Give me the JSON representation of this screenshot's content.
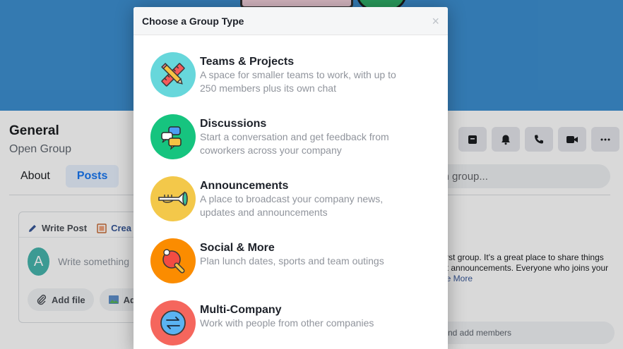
{
  "group": {
    "name": "General",
    "type": "Open Group",
    "tabs": [
      "About",
      "Posts"
    ],
    "search_placeholder": "ch group...",
    "composer": {
      "tab_write": "Write Post",
      "tab_create": "Crea",
      "avatar_initial": "A",
      "placeholder": "Write something",
      "add_file": "Add file",
      "add_photo": "Ad"
    },
    "about": {
      "heading": "n",
      "text_line1": "first group. It's a great place to share things",
      "text_line2": "nt announcements. Everyone who joins your",
      "see_more": "ee More"
    },
    "add_members": "nd add members"
  },
  "dialog": {
    "title": "Choose a Group Type",
    "close": "×",
    "types": [
      {
        "name": "Teams & Projects",
        "desc_line1": "A space for smaller teams to work, with up to",
        "desc_line2": "250 members plus its own chat",
        "color": "#67d7db",
        "icon": "ruler-pencil-icon"
      },
      {
        "name": "Discussions",
        "desc_line1": "Start a conversation and get feedback from",
        "desc_line2": "coworkers across your company",
        "color": "#16c47f",
        "icon": "chat-bubbles-icon"
      },
      {
        "name": "Announcements",
        "desc_line1": "A place to broadcast your company news,",
        "desc_line2": "updates and announcements",
        "color": "#f3c84a",
        "icon": "trumpet-icon"
      },
      {
        "name": "Social & More",
        "desc_line1": "Plan lunch dates, sports and team outings",
        "desc_line2": "",
        "color": "#fb8c00",
        "icon": "ping-pong-icon"
      },
      {
        "name": "Multi-Company",
        "desc_line1": "Work with people from other companies",
        "desc_line2": "",
        "color": "#f5665d",
        "icon": "exchange-arrows-icon"
      }
    ]
  }
}
